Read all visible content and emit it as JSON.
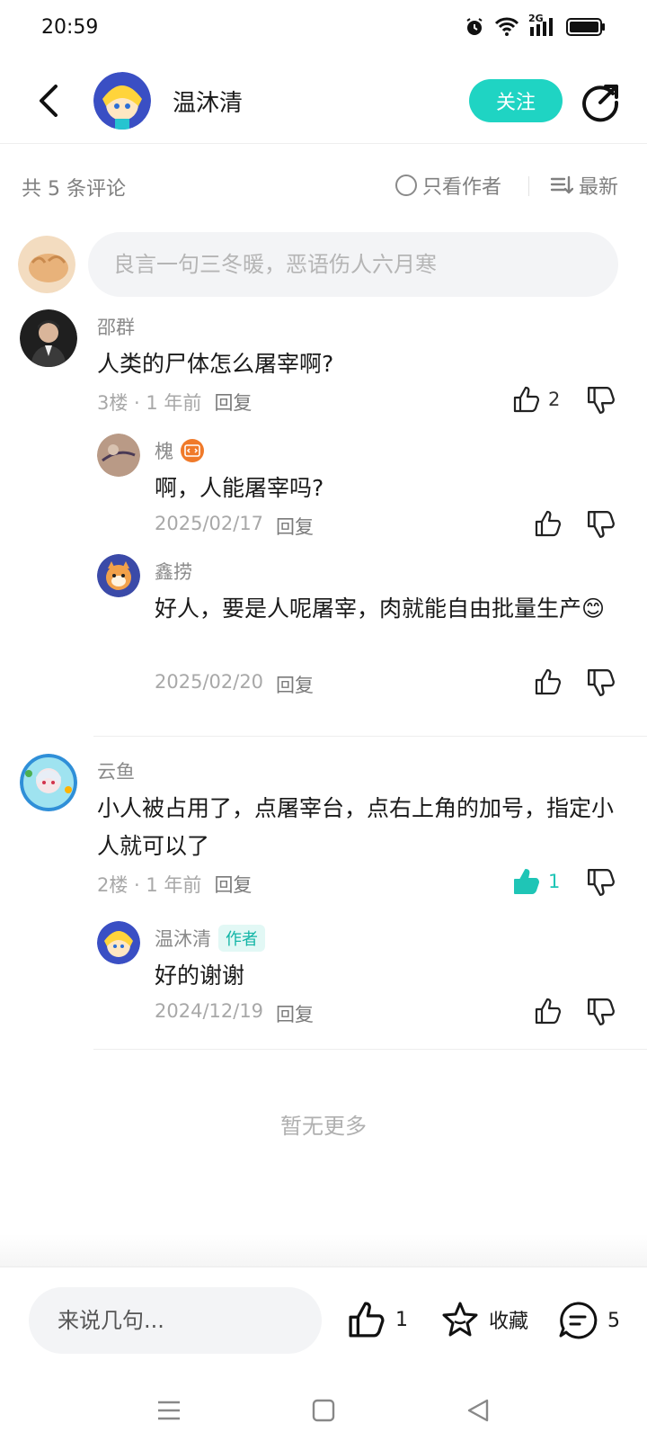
{
  "status_bar": {
    "time": "20:59",
    "network": "2G"
  },
  "header": {
    "author_name": "温沐清",
    "follow_label": "关注"
  },
  "filter": {
    "count_label": "共 5 条评论",
    "author_only_label": "只看作者",
    "sort_label": "最新"
  },
  "compose": {
    "placeholder": "良言一句三冬暖，恶语伤人六月寒"
  },
  "comments": [
    {
      "name": "邵群",
      "text": "人类的尸体怎么屠宰啊?",
      "floor": "3楼 · 1 年前",
      "reply_label": "回复",
      "likes": "2",
      "liked": false,
      "replies": [
        {
          "name": "槐",
          "text": "啊，人能屠宰吗?",
          "date": "2025/02/17",
          "reply_label": "回复"
        },
        {
          "name": "鑫捞",
          "text": "好人，要是人呢屠宰，肉就能自由批量生产😊",
          "date": "2025/02/20",
          "reply_label": "回复"
        }
      ]
    },
    {
      "name": "云鱼",
      "text": "小人被占用了，点屠宰台，点右上角的加号，指定小人就可以了",
      "floor": "2楼 · 1 年前",
      "reply_label": "回复",
      "likes": "1",
      "liked": true,
      "replies": [
        {
          "name": "温沐清",
          "badge": "作者",
          "text": "好的谢谢",
          "date": "2024/12/19",
          "reply_label": "回复"
        }
      ]
    }
  ],
  "no_more_label": "暂无更多",
  "bottom_bar": {
    "input_placeholder": "来说几句...",
    "like_count": "1",
    "favorite_label": "收藏",
    "comment_count": "5"
  },
  "colors": {
    "accent": "#1fd4c3",
    "muted_text": "#8a8a8a",
    "input_bg": "#f3f4f6"
  }
}
